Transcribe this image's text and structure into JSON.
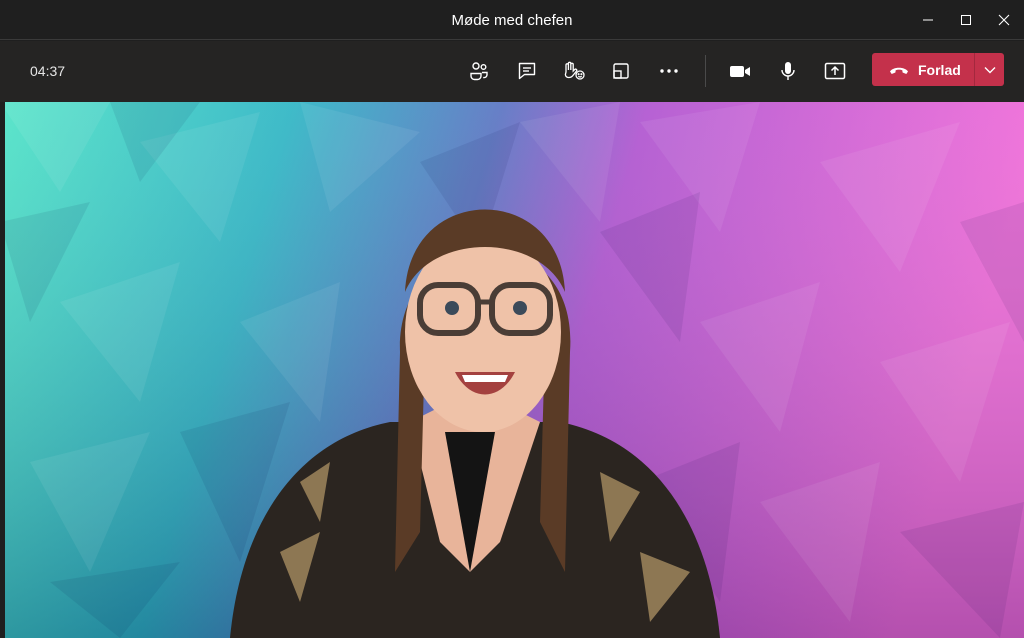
{
  "window": {
    "title": "Møde med chefen",
    "controls": {
      "minimize": "minimize-icon",
      "maximize": "maximize-icon",
      "close": "close-icon"
    }
  },
  "toolbar": {
    "timer": "04:37",
    "buttons": [
      {
        "name": "participants-button",
        "icon": "people-icon"
      },
      {
        "name": "chat-button",
        "icon": "chat-icon"
      },
      {
        "name": "reactions-button",
        "icon": "raise-hand-icon"
      },
      {
        "name": "rooms-button",
        "icon": "breakout-rooms-icon"
      },
      {
        "name": "more-actions-button",
        "icon": "more-icon"
      },
      {
        "name": "camera-button",
        "icon": "camera-icon"
      },
      {
        "name": "mic-button",
        "icon": "microphone-icon"
      },
      {
        "name": "share-button",
        "icon": "share-screen-icon"
      }
    ],
    "leave": {
      "label": "Forlad",
      "icon": "hang-up-icon",
      "dropdown_icon": "chevron-down-icon",
      "color": "#c4314b"
    }
  },
  "video": {
    "background_gradient": [
      "#4ee3c6",
      "#2a9fbf",
      "#6a5fc4",
      "#c25ad6",
      "#f06ad8"
    ]
  }
}
